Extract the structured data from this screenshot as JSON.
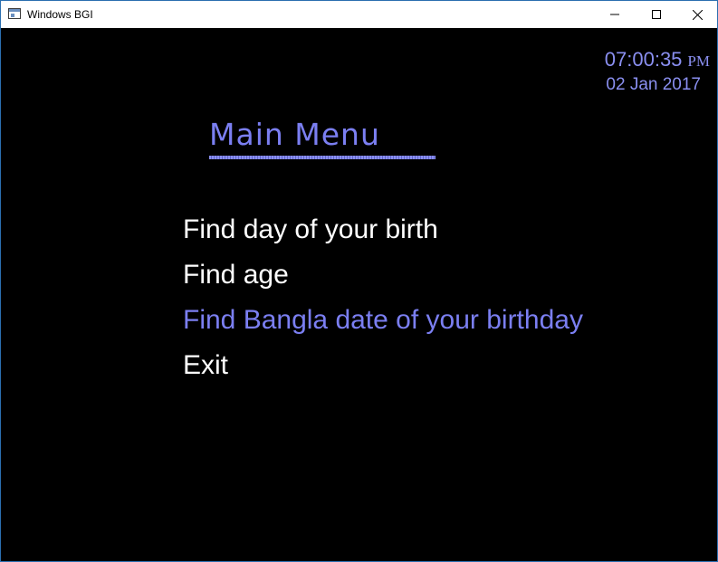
{
  "window": {
    "title": "Windows BGI",
    "icons": {
      "app": "app-window-icon",
      "minimize": "minimize-icon",
      "maximize": "maximize-icon",
      "close": "close-icon"
    }
  },
  "clock": {
    "time": "07:00:35",
    "ampm": "PM",
    "date": "02 Jan 2017"
  },
  "main_menu": {
    "title": "Main Menu",
    "items": [
      {
        "label": "Find day of your birth",
        "selected": false
      },
      {
        "label": "Find age",
        "selected": false
      },
      {
        "label": "Find Bangla date of your birthday",
        "selected": true
      },
      {
        "label": "Exit",
        "selected": false
      }
    ]
  },
  "colors": {
    "background": "#000000",
    "accent": "#7b7ff2",
    "menu_text": "#ffffff",
    "window_border": "#2b6fb0"
  }
}
